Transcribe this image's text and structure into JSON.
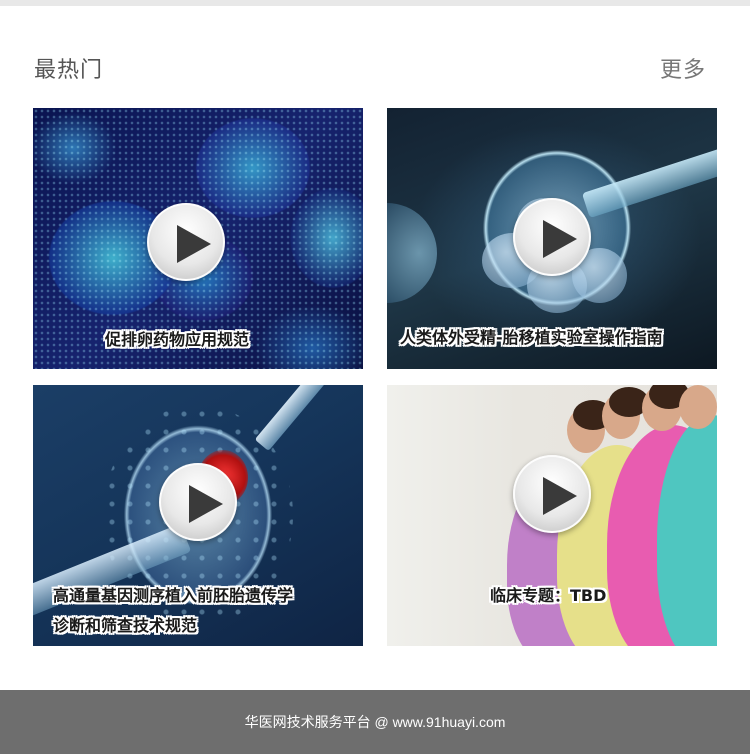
{
  "header": {
    "title": "最热门",
    "more_label": "更多"
  },
  "videos": [
    {
      "caption": "促排卵药物应用规范",
      "icon": "play-icon"
    },
    {
      "caption": "人类体外受精-胎移植实验室操作指南",
      "icon": "play-icon"
    },
    {
      "caption_line1": "高通量基因测序植入前胚胎遗传学",
      "caption_line2": "诊断和筛查技术规范",
      "icon": "play-icon"
    },
    {
      "caption": "临床专题：TBD",
      "icon": "play-icon"
    }
  ],
  "footer": {
    "text": "华医网技术服务平台 @ www.91huayi.com"
  },
  "colors": {
    "footer_bg": "#6e6e6e",
    "title_text": "#555555",
    "caption_text": "#1a1a1a"
  }
}
